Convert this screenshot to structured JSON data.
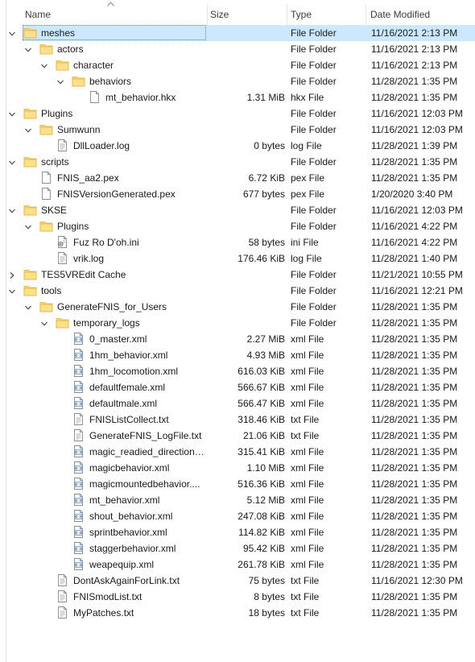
{
  "columns": {
    "name": "Name",
    "size": "Size",
    "type": "Type",
    "date": "Date Modified"
  },
  "selected_row": 0,
  "rows": [
    {
      "depth": 0,
      "kind": "folder",
      "expanded": true,
      "name": "meshes",
      "size": "",
      "type": "File Folder",
      "date": "11/16/2021 2:13 PM"
    },
    {
      "depth": 1,
      "kind": "folder",
      "expanded": true,
      "name": "actors",
      "size": "",
      "type": "File Folder",
      "date": "11/16/2021 2:13 PM"
    },
    {
      "depth": 2,
      "kind": "folder",
      "expanded": true,
      "name": "character",
      "size": "",
      "type": "File Folder",
      "date": "11/16/2021 2:13 PM"
    },
    {
      "depth": 3,
      "kind": "folder",
      "expanded": true,
      "name": "behaviors",
      "size": "",
      "type": "File Folder",
      "date": "11/28/2021 1:35 PM"
    },
    {
      "depth": 4,
      "kind": "file",
      "name": "mt_behavior.hkx",
      "size": "1.31 MiB",
      "type": "hkx File",
      "date": "11/28/2021 1:35 PM"
    },
    {
      "depth": 0,
      "kind": "folder",
      "expanded": true,
      "name": "Plugins",
      "size": "",
      "type": "File Folder",
      "date": "11/16/2021 12:03 PM"
    },
    {
      "depth": 1,
      "kind": "folder",
      "expanded": true,
      "name": "Sumwunn",
      "size": "",
      "type": "File Folder",
      "date": "11/16/2021 12:03 PM"
    },
    {
      "depth": 2,
      "kind": "text",
      "name": "DllLoader.log",
      "size": "0 bytes",
      "type": "log File",
      "date": "11/28/2021 1:39 PM"
    },
    {
      "depth": 0,
      "kind": "folder",
      "expanded": true,
      "name": "scripts",
      "size": "",
      "type": "File Folder",
      "date": "11/28/2021 1:35 PM"
    },
    {
      "depth": 1,
      "kind": "file",
      "name": "FNIS_aa2.pex",
      "size": "6.72 KiB",
      "type": "pex File",
      "date": "11/28/2021 1:35 PM"
    },
    {
      "depth": 1,
      "kind": "file",
      "name": "FNISVersionGenerated.pex",
      "size": "677 bytes",
      "type": "pex File",
      "date": "1/20/2020 3:40 PM"
    },
    {
      "depth": 0,
      "kind": "folder",
      "expanded": true,
      "name": "SKSE",
      "size": "",
      "type": "File Folder",
      "date": "11/16/2021 12:03 PM"
    },
    {
      "depth": 1,
      "kind": "folder",
      "expanded": true,
      "name": "Plugins",
      "size": "",
      "type": "File Folder",
      "date": "11/16/2021 4:22 PM"
    },
    {
      "depth": 2,
      "kind": "ini",
      "name": "Fuz Ro D'oh.ini",
      "size": "58 bytes",
      "type": "ini File",
      "date": "11/16/2021 4:22 PM"
    },
    {
      "depth": 2,
      "kind": "text",
      "name": "vrik.log",
      "size": "176.46 KiB",
      "type": "log File",
      "date": "11/28/2021 1:40 PM"
    },
    {
      "depth": 0,
      "kind": "folder",
      "expanded": false,
      "name": "TES5VREdit Cache",
      "size": "",
      "type": "File Folder",
      "date": "11/21/2021 10:55 PM"
    },
    {
      "depth": 0,
      "kind": "folder",
      "expanded": true,
      "name": "tools",
      "size": "",
      "type": "File Folder",
      "date": "11/16/2021 12:21 PM"
    },
    {
      "depth": 1,
      "kind": "folder",
      "expanded": true,
      "name": "GenerateFNIS_for_Users",
      "size": "",
      "type": "File Folder",
      "date": "11/28/2021 1:35 PM"
    },
    {
      "depth": 2,
      "kind": "folder",
      "expanded": true,
      "name": "temporary_logs",
      "size": "",
      "type": "File Folder",
      "date": "11/28/2021 1:35 PM"
    },
    {
      "depth": 3,
      "kind": "xml",
      "name": "0_master.xml",
      "size": "2.27 MiB",
      "type": "xml File",
      "date": "11/28/2021 1:35 PM"
    },
    {
      "depth": 3,
      "kind": "xml",
      "name": "1hm_behavior.xml",
      "size": "4.93 MiB",
      "type": "xml File",
      "date": "11/28/2021 1:35 PM"
    },
    {
      "depth": 3,
      "kind": "xml",
      "name": "1hm_locomotion.xml",
      "size": "616.03 KiB",
      "type": "xml File",
      "date": "11/28/2021 1:35 PM"
    },
    {
      "depth": 3,
      "kind": "xml",
      "name": "defaultfemale.xml",
      "size": "566.67 KiB",
      "type": "xml File",
      "date": "11/28/2021 1:35 PM"
    },
    {
      "depth": 3,
      "kind": "xml",
      "name": "defaultmale.xml",
      "size": "566.47 KiB",
      "type": "xml File",
      "date": "11/28/2021 1:35 PM"
    },
    {
      "depth": 3,
      "kind": "text",
      "name": "FNISListCollect.txt",
      "size": "318.46 KiB",
      "type": "txt File",
      "date": "11/28/2021 1:35 PM"
    },
    {
      "depth": 3,
      "kind": "text",
      "name": "GenerateFNIS_LogFile.txt",
      "size": "21.06 KiB",
      "type": "txt File",
      "date": "11/28/2021 1:35 PM"
    },
    {
      "depth": 3,
      "kind": "xml",
      "name": "magic_readied_direction…",
      "size": "315.41 KiB",
      "type": "xml File",
      "date": "11/28/2021 1:35 PM"
    },
    {
      "depth": 3,
      "kind": "xml",
      "name": "magicbehavior.xml",
      "size": "1.10 MiB",
      "type": "xml File",
      "date": "11/28/2021 1:35 PM"
    },
    {
      "depth": 3,
      "kind": "xml",
      "name": "magicmountedbehavior....",
      "size": "516.36 KiB",
      "type": "xml File",
      "date": "11/28/2021 1:35 PM"
    },
    {
      "depth": 3,
      "kind": "xml",
      "name": "mt_behavior.xml",
      "size": "5.12 MiB",
      "type": "xml File",
      "date": "11/28/2021 1:35 PM"
    },
    {
      "depth": 3,
      "kind": "xml",
      "name": "shout_behavior.xml",
      "size": "247.08 KiB",
      "type": "xml File",
      "date": "11/28/2021 1:35 PM"
    },
    {
      "depth": 3,
      "kind": "xml",
      "name": "sprintbehavior.xml",
      "size": "114.82 KiB",
      "type": "xml File",
      "date": "11/28/2021 1:35 PM"
    },
    {
      "depth": 3,
      "kind": "xml",
      "name": "staggerbehavior.xml",
      "size": "95.42 KiB",
      "type": "xml File",
      "date": "11/28/2021 1:35 PM"
    },
    {
      "depth": 3,
      "kind": "xml",
      "name": "weapequip.xml",
      "size": "261.78 KiB",
      "type": "xml File",
      "date": "11/28/2021 1:35 PM"
    },
    {
      "depth": 2,
      "kind": "text",
      "name": "DontAskAgainForLink.txt",
      "size": "75 bytes",
      "type": "txt File",
      "date": "11/16/2021 12:30 PM"
    },
    {
      "depth": 2,
      "kind": "text",
      "name": "FNISmodList.txt",
      "size": "8 bytes",
      "type": "txt File",
      "date": "11/28/2021 1:35 PM"
    },
    {
      "depth": 2,
      "kind": "text",
      "name": "MyPatches.txt",
      "size": "18 bytes",
      "type": "txt File",
      "date": "11/28/2021 1:35 PM"
    }
  ]
}
